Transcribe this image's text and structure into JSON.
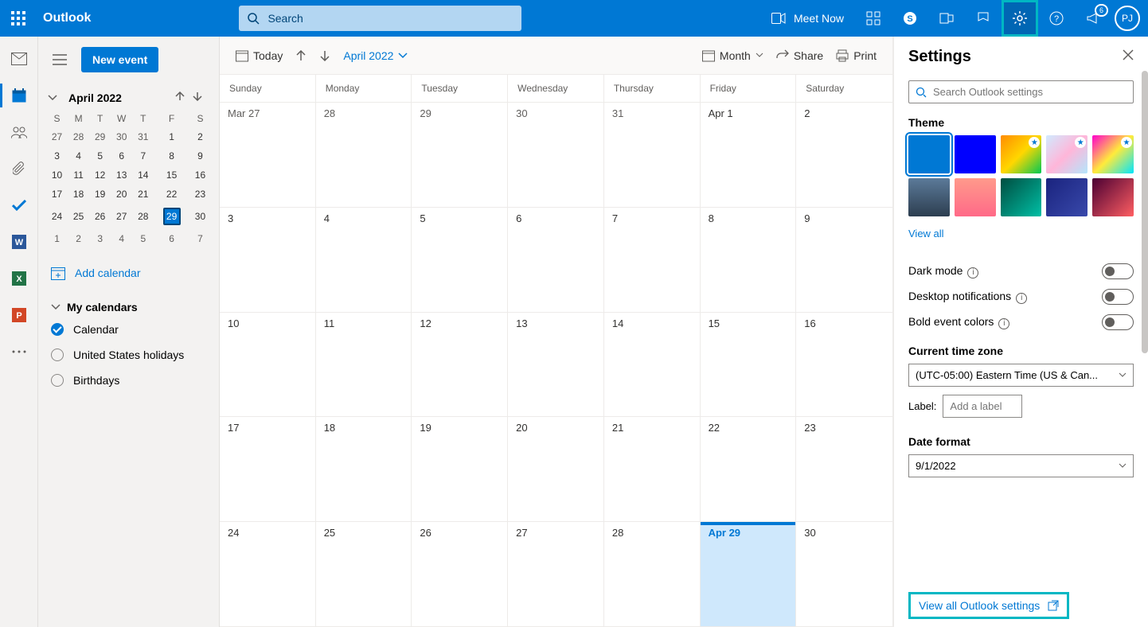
{
  "header": {
    "brand": "Outlook",
    "search_placeholder": "Search",
    "meet_now": "Meet Now",
    "avatar_initials": "PJ",
    "notification_count": "6"
  },
  "sidebar": {
    "new_event": "New event",
    "month_label": "April 2022",
    "weekdays": [
      "S",
      "M",
      "T",
      "W",
      "T",
      "F",
      "S"
    ],
    "add_calendar": "Add calendar",
    "my_calendars": "My calendars",
    "calendars": [
      {
        "name": "Calendar",
        "checked": true
      },
      {
        "name": "United States holidays",
        "checked": false
      },
      {
        "name": "Birthdays",
        "checked": false
      }
    ],
    "mini_cal_rows": [
      [
        {
          "d": "27",
          "in": false
        },
        {
          "d": "28",
          "in": false
        },
        {
          "d": "29",
          "in": false
        },
        {
          "d": "30",
          "in": false
        },
        {
          "d": "31",
          "in": false
        },
        {
          "d": "1",
          "in": true
        },
        {
          "d": "2",
          "in": true
        }
      ],
      [
        {
          "d": "3",
          "in": true
        },
        {
          "d": "4",
          "in": true
        },
        {
          "d": "5",
          "in": true
        },
        {
          "d": "6",
          "in": true
        },
        {
          "d": "7",
          "in": true
        },
        {
          "d": "8",
          "in": true
        },
        {
          "d": "9",
          "in": true
        }
      ],
      [
        {
          "d": "10",
          "in": true
        },
        {
          "d": "11",
          "in": true
        },
        {
          "d": "12",
          "in": true
        },
        {
          "d": "13",
          "in": true
        },
        {
          "d": "14",
          "in": true
        },
        {
          "d": "15",
          "in": true
        },
        {
          "d": "16",
          "in": true
        }
      ],
      [
        {
          "d": "17",
          "in": true
        },
        {
          "d": "18",
          "in": true
        },
        {
          "d": "19",
          "in": true
        },
        {
          "d": "20",
          "in": true
        },
        {
          "d": "21",
          "in": true
        },
        {
          "d": "22",
          "in": true
        },
        {
          "d": "23",
          "in": true
        }
      ],
      [
        {
          "d": "24",
          "in": true
        },
        {
          "d": "25",
          "in": true
        },
        {
          "d": "26",
          "in": true
        },
        {
          "d": "27",
          "in": true
        },
        {
          "d": "28",
          "in": true
        },
        {
          "d": "29",
          "in": true,
          "sel": true
        },
        {
          "d": "30",
          "in": true
        }
      ],
      [
        {
          "d": "1",
          "in": false
        },
        {
          "d": "2",
          "in": false
        },
        {
          "d": "3",
          "in": false
        },
        {
          "d": "4",
          "in": false
        },
        {
          "d": "5",
          "in": false
        },
        {
          "d": "6",
          "in": false
        },
        {
          "d": "7",
          "in": false
        }
      ]
    ]
  },
  "toolbar": {
    "today": "Today",
    "month_label": "April 2022",
    "view": "Month",
    "share": "Share",
    "print": "Print"
  },
  "calendar": {
    "weekdays": [
      "Sunday",
      "Monday",
      "Tuesday",
      "Wednesday",
      "Thursday",
      "Friday",
      "Saturday"
    ],
    "cells": [
      {
        "label": "Mar 27",
        "in": false
      },
      {
        "label": "28",
        "in": false
      },
      {
        "label": "29",
        "in": false
      },
      {
        "label": "30",
        "in": false
      },
      {
        "label": "31",
        "in": false
      },
      {
        "label": "Apr 1",
        "in": true
      },
      {
        "label": "2",
        "in": true
      },
      {
        "label": "3",
        "in": true
      },
      {
        "label": "4",
        "in": true
      },
      {
        "label": "5",
        "in": true
      },
      {
        "label": "6",
        "in": true
      },
      {
        "label": "7",
        "in": true
      },
      {
        "label": "8",
        "in": true
      },
      {
        "label": "9",
        "in": true
      },
      {
        "label": "10",
        "in": true
      },
      {
        "label": "11",
        "in": true
      },
      {
        "label": "12",
        "in": true
      },
      {
        "label": "13",
        "in": true
      },
      {
        "label": "14",
        "in": true
      },
      {
        "label": "15",
        "in": true
      },
      {
        "label": "16",
        "in": true
      },
      {
        "label": "17",
        "in": true
      },
      {
        "label": "18",
        "in": true
      },
      {
        "label": "19",
        "in": true
      },
      {
        "label": "20",
        "in": true
      },
      {
        "label": "21",
        "in": true
      },
      {
        "label": "22",
        "in": true
      },
      {
        "label": "23",
        "in": true
      },
      {
        "label": "24",
        "in": true
      },
      {
        "label": "25",
        "in": true
      },
      {
        "label": "26",
        "in": true
      },
      {
        "label": "27",
        "in": true
      },
      {
        "label": "28",
        "in": true
      },
      {
        "label": "Apr 29",
        "in": true,
        "today": true
      },
      {
        "label": "30",
        "in": true
      }
    ]
  },
  "settings": {
    "title": "Settings",
    "search_placeholder": "Search Outlook settings",
    "theme_label": "Theme",
    "view_all": "View all",
    "dark_mode": "Dark mode",
    "desktop_notifications": "Desktop notifications",
    "bold_colors": "Bold event colors",
    "tz_label": "Current time zone",
    "tz_value": "(UTC-05:00) Eastern Time (US & Can...",
    "label_label": "Label:",
    "label_placeholder": "Add a label",
    "date_format_label": "Date format",
    "date_format_value": "9/1/2022",
    "view_all_settings": "View all Outlook settings",
    "themes": [
      {
        "bg": "#0078d4",
        "selected": true
      },
      {
        "bg": "#0000ff"
      },
      {
        "bg": "linear-gradient(135deg,#ff8c00,#ffd700,#00c853)",
        "star": true
      },
      {
        "bg": "linear-gradient(135deg,#d0eaff,#ffb6d9,#b3e5fc)",
        "star": true
      },
      {
        "bg": "linear-gradient(135deg,#ff00cc,#ffeb3b,#00e5ff)",
        "star": true
      },
      {
        "bg": "linear-gradient(180deg,#5b7a99,#2d3e50)"
      },
      {
        "bg": "linear-gradient(180deg,#ff9a8b,#ff6a88)"
      },
      {
        "bg": "linear-gradient(135deg,#004d40,#00bfa5)"
      },
      {
        "bg": "linear-gradient(135deg,#1a237e,#3949ab)"
      },
      {
        "bg": "linear-gradient(135deg,#4a0033,#ff5e62)"
      }
    ]
  }
}
